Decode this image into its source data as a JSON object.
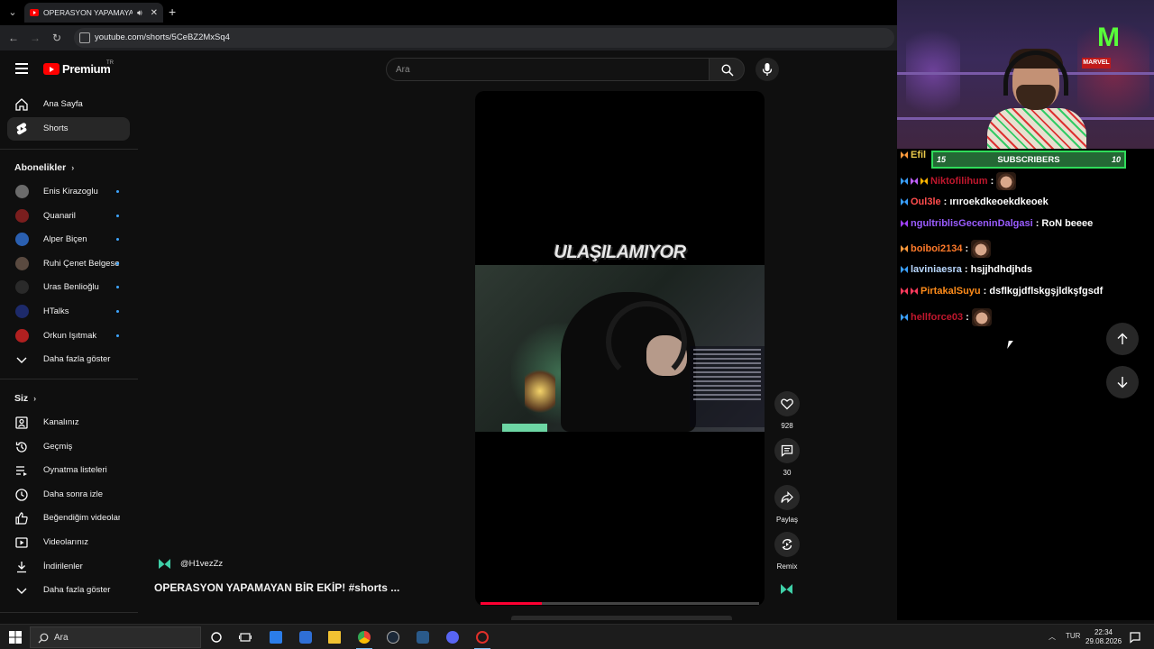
{
  "browser": {
    "tab_title": "OPERASYON YAPAMAYAN BİR EKİP! #shorts ...",
    "url": "youtube.com/shorts/5CeBZ2MxSq4"
  },
  "header": {
    "logo_text": "Premium",
    "logo_sup": "TR",
    "search_placeholder": "Ara"
  },
  "sidebar": {
    "main": [
      {
        "label": "Ana Sayfa",
        "icon": "home-icon"
      },
      {
        "label": "Shorts",
        "icon": "shorts-icon",
        "active": true
      }
    ],
    "subs_heading": "Abonelikler",
    "subs": [
      {
        "label": "Enis Kirazoglu",
        "color": "#6b6b6b"
      },
      {
        "label": "Quanaril",
        "color": "#7a1e1e"
      },
      {
        "label": "Alper Biçen",
        "color": "#2a5fb0"
      },
      {
        "label": "Ruhi Çenet Belgeselleri",
        "color": "#5a4a40"
      },
      {
        "label": "Uras Benlioğlu",
        "color": "#2a2a2a"
      },
      {
        "label": "HTalks",
        "color": "#1d2a6a"
      },
      {
        "label": "Orkun Işıtmak",
        "color": "#b02020"
      }
    ],
    "subs_more": "Daha fazla göster",
    "you_heading": "Siz",
    "you": [
      {
        "label": "Kanalınız",
        "icon": "channel-icon"
      },
      {
        "label": "Geçmiş",
        "icon": "history-icon"
      },
      {
        "label": "Oynatma listeleri",
        "icon": "playlist-icon"
      },
      {
        "label": "Daha sonra izle",
        "icon": "clock-icon"
      },
      {
        "label": "Beğendiğim videolar",
        "icon": "thumbs-up-icon"
      },
      {
        "label": "Videolarınız",
        "icon": "video-icon"
      },
      {
        "label": "İndirilenler",
        "icon": "download-icon"
      },
      {
        "label": "Daha fazla göster",
        "icon": "chevron-down-icon"
      }
    ]
  },
  "short": {
    "banner": "ULAŞILAMIYOR",
    "progress": 0.22,
    "channel_handle": "@H1vezZz",
    "title": "OPERASYON YAPAMAYAN BİR EKİP! #shorts ...",
    "actions": {
      "likes": "928",
      "comments": "30",
      "share": "Paylaş",
      "remix": "Remix"
    }
  },
  "stream": {
    "sub_goal": {
      "current": "15",
      "label": "SUBSCRIBERS",
      "target": "10",
      "fill": 1.0
    },
    "chat": [
      {
        "user": "Efil",
        "color": "#e8c84a",
        "badges": [
          "#ff9a3c"
        ],
        "msg": "",
        "emote": false
      },
      {
        "user": "Niktofilihum",
        "color": "#c0172d",
        "badges": [
          "#3aa0ff",
          "#c060ff",
          "#ffb400"
        ],
        "msg": " :",
        "emote": true
      },
      {
        "user": "Oul3le",
        "color": "#ff4d4d",
        "badges": [
          "#3aa0ff"
        ],
        "msg": " : ırıroekdkeoekdkeoek",
        "emote": false
      },
      {
        "user": "ngultriblisGeceninDalgasi",
        "color": "#9a5cff",
        "badges": [
          "#a040ff"
        ],
        "msg": " : RoN beeee",
        "emote": false
      },
      {
        "user": "boiboi2134",
        "color": "#ff7a2a",
        "badges": [
          "#ff9a3c"
        ],
        "msg": " :",
        "emote": true
      },
      {
        "user": "laviniaesra",
        "color": "#b9d8ff",
        "badges": [
          "#3aa0ff"
        ],
        "msg": " : hsjjhdhdjhds",
        "emote": false
      },
      {
        "user": "PirtakalSuyu",
        "color": "#ff8c1a",
        "badges": [
          "#ff3a5c",
          "#ff3a5c"
        ],
        "msg": " : dsflkgjdflskgşjldkşfgsdf",
        "emote": false
      },
      {
        "user": "hellforce03",
        "color": "#c0172d",
        "badges": [
          "#3aa0ff"
        ],
        "msg": " :",
        "emote": true
      }
    ]
  },
  "taskbar": {
    "search": "Ara",
    "lang": "TUR",
    "time": "22:34",
    "date": "29.08.2026"
  }
}
